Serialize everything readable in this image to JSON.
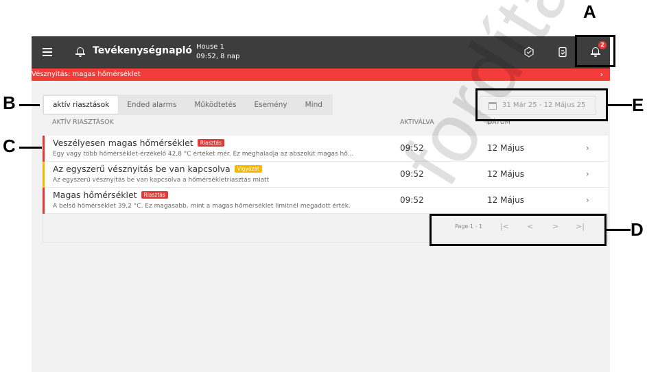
{
  "topbar": {
    "menu_icon": "hamburger-icon",
    "bell_icon": "bell-icon",
    "title": "Tevékenységnapló",
    "house_name": "House 1",
    "house_time": "09:52, 8 nap",
    "notification_count": "2"
  },
  "warning": {
    "text": "Vésznyitás: magas hőmérséklet",
    "chevron": "›",
    "color": "#f23b3b"
  },
  "tabs": [
    {
      "label": "aktív riasztások",
      "active": true
    },
    {
      "label": "Ended alarms"
    },
    {
      "label": "Működtetés"
    },
    {
      "label": "Esemény"
    },
    {
      "label": "Mind"
    }
  ],
  "date_range": "31 Már 25 - 12 Május 25",
  "columns": {
    "alarms": "AKTÍV RIASZTÁSOK",
    "activated": "AKTIVÁLVA",
    "date": "DÁTUM"
  },
  "rows": [
    {
      "title": "Veszélyesen magas hőmérséklet",
      "badge": "Riasztás",
      "badge_color": "#e53935",
      "description": "Egy vagy több hőmérséklet-érzékelő 42,8 °C értéket mér. Ez meghaladja az abszolút magas hő...",
      "time": "09:52",
      "date": "12 Május",
      "chevron": "›"
    },
    {
      "title": "Az egyszerű vésznyitás be van kapcsolva",
      "badge": "Vigyázat",
      "badge_color": "#f5b800",
      "description": "Az egyszerű vésznyitás be van kapcsolva a hőmérsékletriasztás miatt",
      "time": "09:52",
      "date": "12 Május",
      "chevron": "›"
    },
    {
      "title": "Magas hőmérséklet",
      "badge": "Riasztás",
      "badge_color": "#e53935",
      "description": "A belső hőmérséklet 39,2 °C. Ez magasabb, mint a magas hőmérséklet limitnél megadott érték.",
      "time": "09:52",
      "date": "12 Május",
      "chevron": "›"
    }
  ],
  "pager": {
    "info": "Page 1 - 1",
    "first": "|<",
    "prev": "<",
    "next": ">",
    "last": ">|"
  },
  "callouts": {
    "a": "A",
    "b": "B",
    "c": "C",
    "d": "D",
    "e": "E"
  },
  "watermark": "fordítás"
}
